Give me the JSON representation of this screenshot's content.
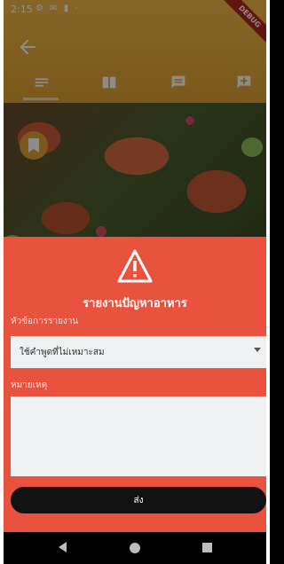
{
  "status_bar": {
    "time": "2:15",
    "icons": "⚙ ✉ ▮ ⋅"
  },
  "debug_badge": "DEBUG",
  "food_image_alt": "",
  "report_sheet": {
    "title": "รายงานปัญหาอาหาร",
    "topic_label": "หัวข้อการรายงาน",
    "topic_value": "ใช้คำพูดที่ไม่เหมาะสม",
    "notes_label": "หมายเหตุ",
    "notes_value": "",
    "send_label": "ส่ง"
  },
  "colors": {
    "header": "#f3b84a",
    "sheet": "#e8523f",
    "button": "#121212"
  }
}
